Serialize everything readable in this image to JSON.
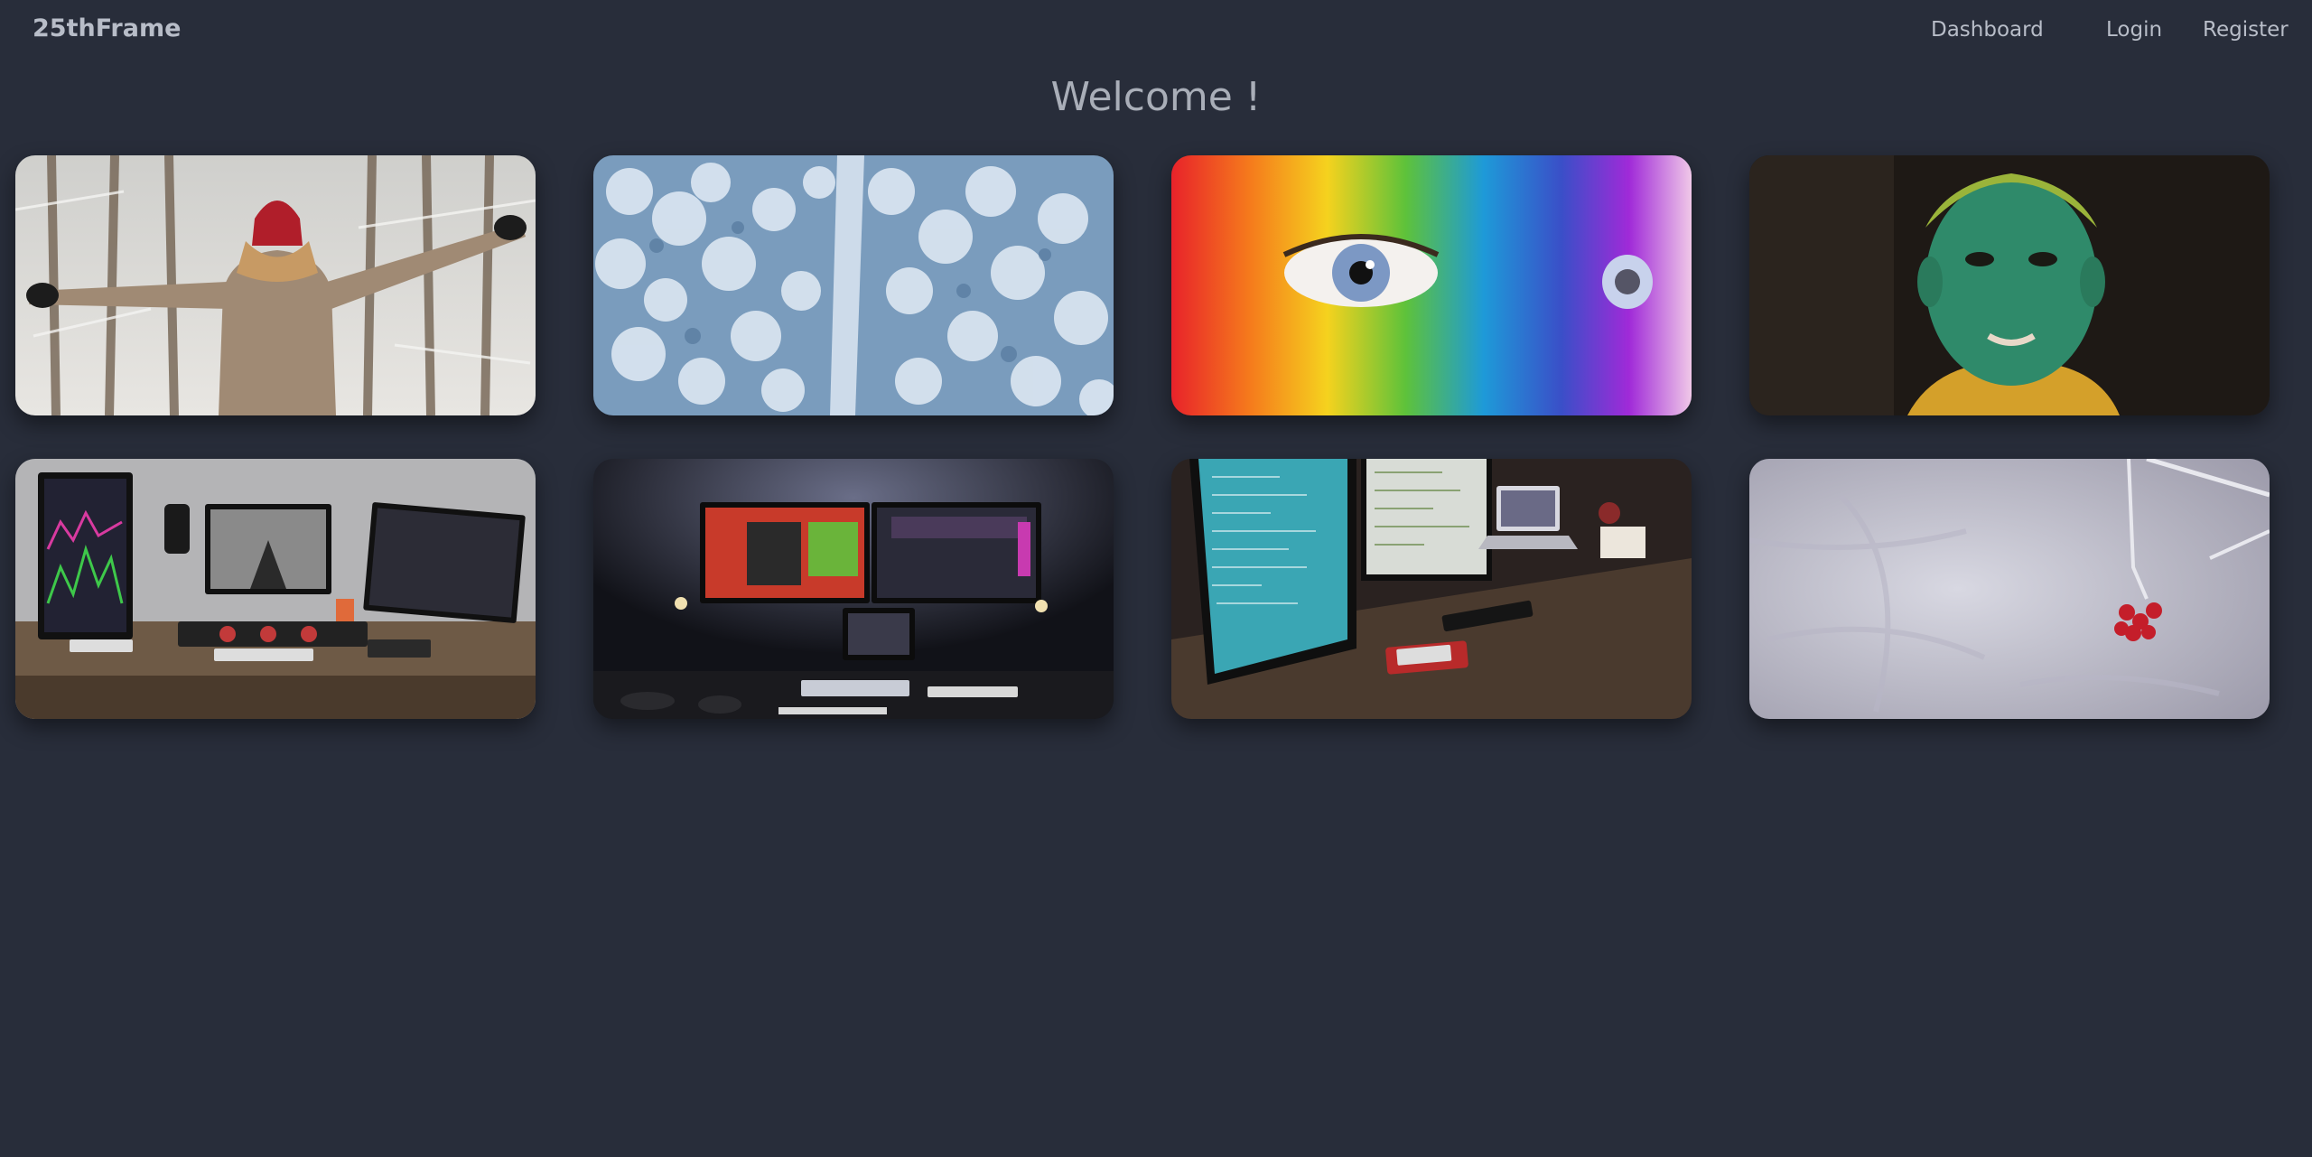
{
  "brand": "25thFrame",
  "nav": {
    "dashboard": "Dashboard",
    "login": "Login",
    "register": "Register"
  },
  "page_title": "Welcome !",
  "colors": {
    "background": "#282d3a",
    "nav_text": "#b8bdc8",
    "title_text": "#a9aeb8"
  },
  "gallery": [
    {
      "subject": "woman-in-snowy-forest"
    },
    {
      "subject": "aerial-snowy-forest-road"
    },
    {
      "subject": "rainbow-painted-face-eye"
    },
    {
      "subject": "boy-with-green-powder"
    },
    {
      "subject": "video-editing-desk-setup"
    },
    {
      "subject": "dark-gaming-dual-monitor-setup"
    },
    {
      "subject": "programmer-desk-setup"
    },
    {
      "subject": "frozen-red-berries"
    }
  ]
}
